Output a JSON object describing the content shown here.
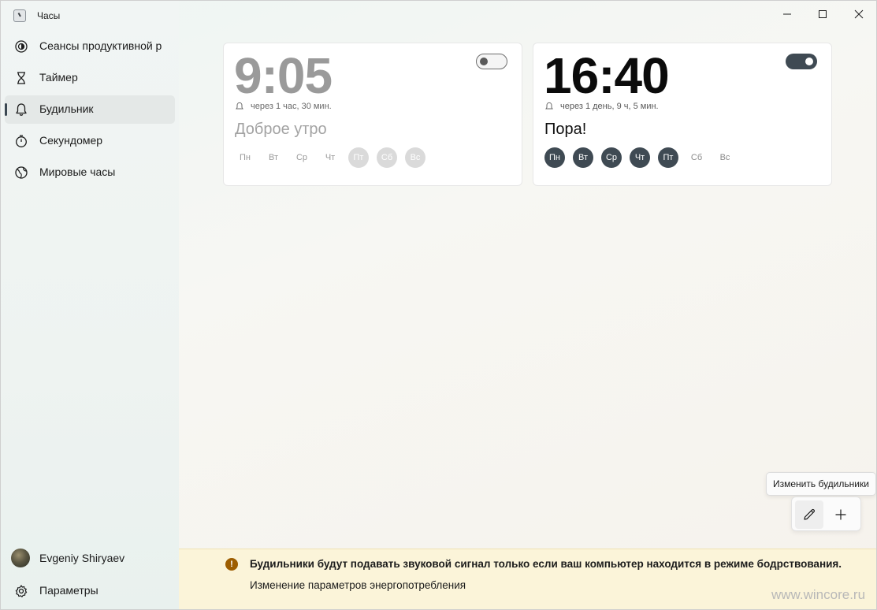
{
  "app": {
    "title": "Часы"
  },
  "window_controls": {
    "minimize": "—",
    "maximize": "☐",
    "close": "✕"
  },
  "sidebar": {
    "items": [
      {
        "label": "Сеансы продуктивной работы",
        "icon": "focus-icon",
        "active": false
      },
      {
        "label": "Таймер",
        "icon": "hourglass-icon",
        "active": false
      },
      {
        "label": "Будильник",
        "icon": "bell-icon",
        "active": true
      },
      {
        "label": "Секундомер",
        "icon": "stopwatch-icon",
        "active": false
      },
      {
        "label": "Мировые часы",
        "icon": "globe-icon",
        "active": false
      }
    ],
    "user": {
      "name": "Evgeniy Shiryaev"
    },
    "settings": {
      "label": "Параметры",
      "icon": "gear-icon"
    }
  },
  "alarms": [
    {
      "time": "9:05",
      "enabled": false,
      "countdown": "через 1 час, 30 мин.",
      "name": "Доброе утро",
      "days": [
        {
          "label": "Пн",
          "selected": false
        },
        {
          "label": "Вт",
          "selected": false
        },
        {
          "label": "Ср",
          "selected": false
        },
        {
          "label": "Чт",
          "selected": false
        },
        {
          "label": "Пт",
          "selected": true
        },
        {
          "label": "Сб",
          "selected": true
        },
        {
          "label": "Вс",
          "selected": true
        }
      ]
    },
    {
      "time": "16:40",
      "enabled": true,
      "countdown": "через 1 день, 9 ч, 5 мин.",
      "name": "Пора!",
      "days": [
        {
          "label": "Пн",
          "selected": true
        },
        {
          "label": "Вт",
          "selected": true
        },
        {
          "label": "Ср",
          "selected": true
        },
        {
          "label": "Чт",
          "selected": true
        },
        {
          "label": "Пт",
          "selected": true
        },
        {
          "label": "Сб",
          "selected": false
        },
        {
          "label": "Вс",
          "selected": false
        }
      ]
    }
  ],
  "toolbar": {
    "tooltip": "Изменить будильники",
    "edit_icon": "pencil-icon",
    "add_icon": "plus-icon"
  },
  "infobar": {
    "icon": "warning-icon",
    "message": "Будильники будут подавать звуковой сигнал только если ваш компьютер находится в режиме бодрствования.",
    "link": "Изменение параметров энергопотребления"
  },
  "watermark": "www.wincore.ru",
  "colors": {
    "accent": "#3f4a53",
    "info_bg": "#fbf4d9",
    "info_icon": "#9d5d00"
  }
}
